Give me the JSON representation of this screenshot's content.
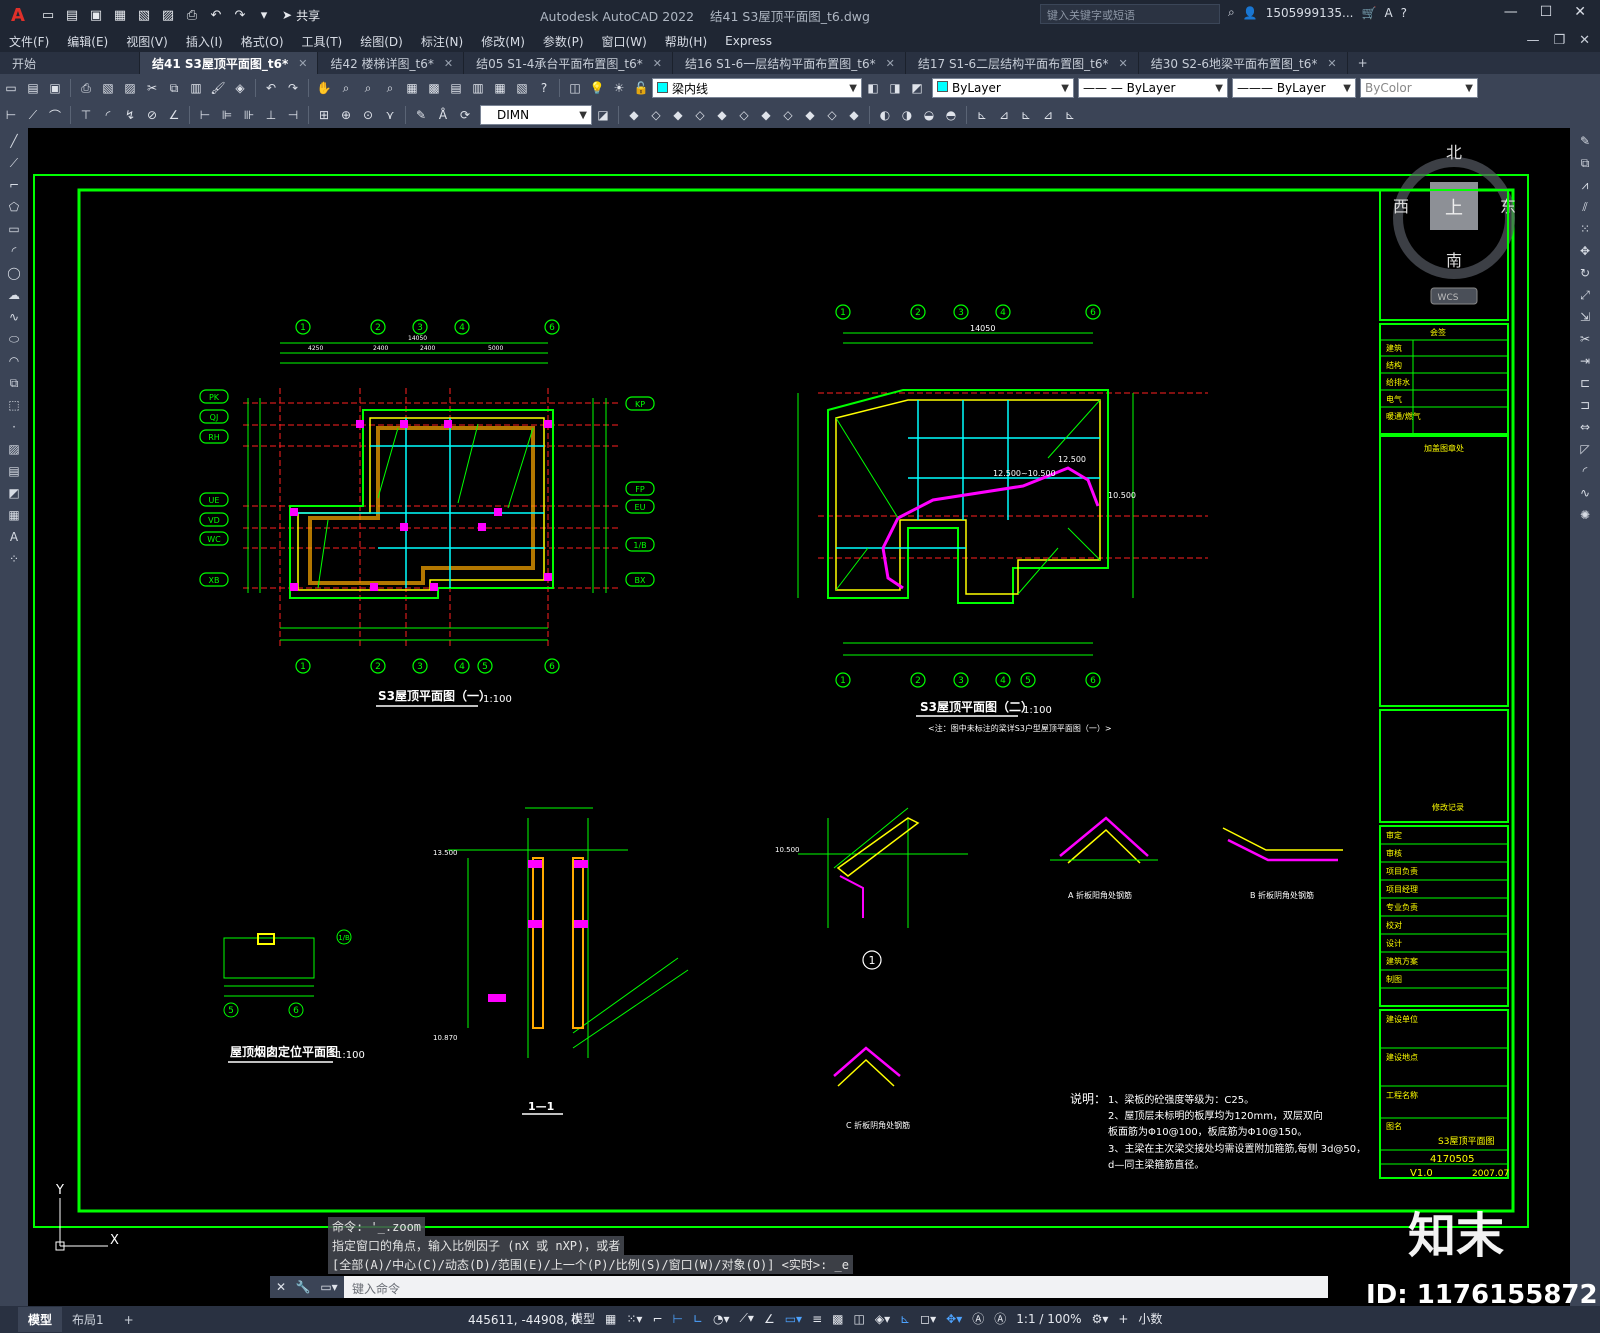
{
  "titlebar": {
    "logo": "A",
    "share_label": "共享",
    "app_title": "Autodesk AutoCAD 2022",
    "file_title": "结41 S3屋顶平面图_t6.dwg",
    "search_placeholder": "键入关键字或短语",
    "user": "1505999135...",
    "help": "?"
  },
  "menu": [
    "文件(F)",
    "编辑(E)",
    "视图(V)",
    "插入(I)",
    "格式(O)",
    "工具(T)",
    "绘图(D)",
    "标注(N)",
    "修改(M)",
    "参数(P)",
    "窗口(W)",
    "帮助(H)",
    "Express"
  ],
  "tabs": [
    {
      "label": "开始",
      "active": false
    },
    {
      "label": "结41 S3屋顶平面图_t6*",
      "active": true
    },
    {
      "label": "结42 楼梯详图_t6*",
      "active": false
    },
    {
      "label": "结05 S1-4承台平面布置图_t6*",
      "active": false
    },
    {
      "label": "结16 S1-6一层结构平面布置图_t6*",
      "active": false
    },
    {
      "label": "结17 S1-6二层结构平面布置图_t6*",
      "active": false
    },
    {
      "label": "结30 S2-6地梁平面布置图_t6*",
      "active": false
    }
  ],
  "toolbar": {
    "layer": "梁内线",
    "color": "ByLayer",
    "linetype": "ByLayer",
    "lineweight": "ByLayer",
    "plotstyle": "ByColor",
    "dimstyle": "DIMN"
  },
  "viewcube": {
    "north": "北",
    "south": "南",
    "east": "东",
    "west": "西",
    "top": "上",
    "wcs": "WCS"
  },
  "drawing": {
    "plan1_title": "S3屋顶平面图（一）",
    "plan1_scale": "1:100",
    "plan2_title": "S3屋顶平面图（二）",
    "plan2_scale": "1:100",
    "plan2_note": "<注：图中未标注的梁详S3户型屋顶平面图（一）>",
    "chimney_title": "屋顶烟囱定位平面图",
    "chimney_scale": "1:100",
    "section_title": "1—1",
    "detail_a": "A 折板阳角处钢筋",
    "detail_b": "B 折板阴角处钢筋",
    "detail_c": "C 折板阴角处钢筋",
    "detail_1": "1",
    "axis_top": [
      "1",
      "2",
      "3",
      "4",
      "6"
    ],
    "axis_bottom1": [
      "1",
      "2",
      "3",
      "4",
      "5",
      "6"
    ],
    "axis_left": [
      "PK",
      "QJ",
      "RH",
      "UE",
      "VD",
      "WC",
      "XB"
    ],
    "axis_right": [
      "KP",
      "FP",
      "EU",
      "1/B",
      "BX"
    ],
    "dims_top": [
      "4250",
      "2400",
      "2400",
      "5000"
    ],
    "overall_dim": "14050",
    "notes_title": "说明：",
    "notes": [
      "1、梁板的砼强度等级为：C25。",
      "2、屋顶层未标明的板厚均为120mm，双层双向",
      "   板面筋为Φ10@100，板底筋为Φ10@150。",
      "3、主梁在主次梁交接处均需设置附加箍筋,每侧 3d@50，",
      "   d—同主梁箍筋直径。"
    ],
    "elev_labels": [
      "12.500~10.500",
      "10.500",
      "12.500",
      "13.500",
      "10.870"
    ]
  },
  "title_block": {
    "sections": [
      "会签",
      "加盖图章处",
      "修改记录",
      "审定",
      "审核",
      "项目负责",
      "项目经理",
      "专业负责",
      "校对",
      "设计",
      "建筑方案",
      "制图",
      "建设单位",
      "建设地点",
      "工程名称",
      "图名"
    ],
    "disciplines": [
      "建筑",
      "结构",
      "给排水",
      "电气",
      "暖通/燃气"
    ],
    "drawing_name": "S3屋顶平面图",
    "contract_no": "4170505",
    "version": "V1.0",
    "date": "2007.07"
  },
  "command": {
    "history": [
      "命令: '_.zoom",
      "指定窗口的角点，输入比例因子 (nX 或 nXP)，或者",
      "[全部(A)/中心(C)/动态(D)/范围(E)/上一个(P)/比例(S)/窗口(W)/对象(O)] <实时>: _e"
    ],
    "placeholder": "键入命令"
  },
  "status": {
    "layout_tabs": [
      "模型",
      "布局1"
    ],
    "coords": "445611, -44908, 0",
    "model": "模型",
    "scale": "1:1 / 100%",
    "units": "小数"
  },
  "watermark": {
    "brand": "知末",
    "id": "ID: 1176155872"
  },
  "ucs": {
    "x": "X",
    "y": "Y"
  },
  "colors": {
    "grid_green": "#00ff00",
    "beam_yellow": "#ffff00",
    "magenta": "#ff00ff",
    "cyan": "#00ffff",
    "red": "#ff2020",
    "ui_dark": "#3b4456"
  }
}
